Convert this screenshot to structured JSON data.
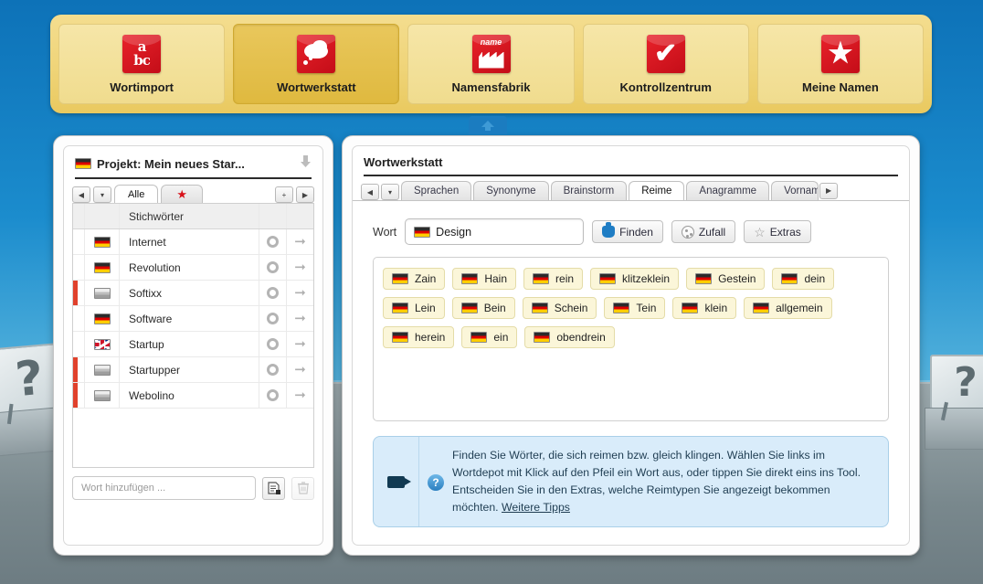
{
  "topnav": {
    "items": [
      {
        "label": "Wortimport",
        "icon": "abc-icon",
        "active": false
      },
      {
        "label": "Wortwerkstatt",
        "icon": "cloud-icon",
        "active": true
      },
      {
        "label": "Namensfabrik",
        "icon": "factory-icon",
        "active": false
      },
      {
        "label": "Kontrollzentrum",
        "icon": "checkmark-icon",
        "active": false
      },
      {
        "label": "Meine Namen",
        "icon": "star-icon",
        "active": false
      }
    ]
  },
  "left_panel": {
    "title": "Projekt: Mein neues Star...",
    "title_flag": "de",
    "download_icon": "download-arrow-icon",
    "tabs": {
      "prev_label": "◀",
      "dropdown_label": "▾",
      "all_label": "Alle",
      "favorite_label": "★",
      "add_label": "+",
      "next_label": "▶"
    },
    "column_header": "Stichwörter",
    "rows": [
      {
        "word": "Internet",
        "flag": "de",
        "flagged": false
      },
      {
        "word": "Revolution",
        "flag": "de",
        "flagged": false
      },
      {
        "word": "Softixx",
        "flag": "neutral",
        "flagged": true
      },
      {
        "word": "Software",
        "flag": "de",
        "flagged": false
      },
      {
        "word": "Startup",
        "flag": "uk",
        "flagged": false
      },
      {
        "word": "Startupper",
        "flag": "neutral",
        "flagged": true
      },
      {
        "word": "Webolino",
        "flag": "neutral",
        "flagged": true
      }
    ],
    "add_placeholder": "Wort hinzufügen ...",
    "add_button_icon": "add-document-icon",
    "delete_button_icon": "trash-icon"
  },
  "right_panel": {
    "title": "Wortwerkstatt",
    "tabs": {
      "prev_label": "◀",
      "dropdown_label": "▾",
      "next_label": "▶",
      "items": [
        {
          "label": "Sprachen",
          "active": false
        },
        {
          "label": "Synonyme",
          "active": false
        },
        {
          "label": "Brainstorm",
          "active": false
        },
        {
          "label": "Reime",
          "active": true
        },
        {
          "label": "Anagramme",
          "active": false
        },
        {
          "label": "Vornam",
          "active": false
        }
      ]
    },
    "search": {
      "label": "Wort",
      "value": "Design",
      "value_flag": "de",
      "buttons": [
        {
          "label": "Finden",
          "icon": "robot-icon"
        },
        {
          "label": "Zufall",
          "icon": "dice-icon"
        },
        {
          "label": "Extras",
          "icon": "star-outline-icon"
        }
      ]
    },
    "results": [
      {
        "word": "Zain",
        "flag": "de"
      },
      {
        "word": "Hain",
        "flag": "de"
      },
      {
        "word": "rein",
        "flag": "de"
      },
      {
        "word": "klitzeklein",
        "flag": "de"
      },
      {
        "word": "Gestein",
        "flag": "de"
      },
      {
        "word": "dein",
        "flag": "de"
      },
      {
        "word": "Lein",
        "flag": "de"
      },
      {
        "word": "Bein",
        "flag": "de"
      },
      {
        "word": "Schein",
        "flag": "de"
      },
      {
        "word": "Tein",
        "flag": "de"
      },
      {
        "word": "klein",
        "flag": "de"
      },
      {
        "word": "allgemein",
        "flag": "de"
      },
      {
        "word": "herein",
        "flag": "de"
      },
      {
        "word": "ein",
        "flag": "de"
      },
      {
        "word": "obendrein",
        "flag": "de"
      }
    ],
    "info": {
      "video_icon": "video-camera-icon",
      "help_icon": "question-mark-icon",
      "text": "Finden Sie Wörter, die sich reimen bzw. gleich klingen. Wählen Sie links im Wortdepot mit Klick auf den Pfeil ein Wort aus, oder tippen Sie direkt eins ins Tool. Entscheiden Sie in den Extras, welche Reimtypen Sie angezeigt bekommen möchten. ",
      "link_label": "Weitere Tipps"
    }
  },
  "background": {
    "billboard_glyph": "?"
  },
  "collapse_handle_icon": "collapse-up-icon",
  "colors": {
    "page_blue": "#0b6fb5",
    "nav_gold": "#efd478",
    "nav_gold_active": "#dfb93f",
    "icon_red": "#d5121a",
    "chip_yellow": "#fbf6d9",
    "info_blue": "#d9ecfa",
    "marker_red": "#e0412c"
  }
}
